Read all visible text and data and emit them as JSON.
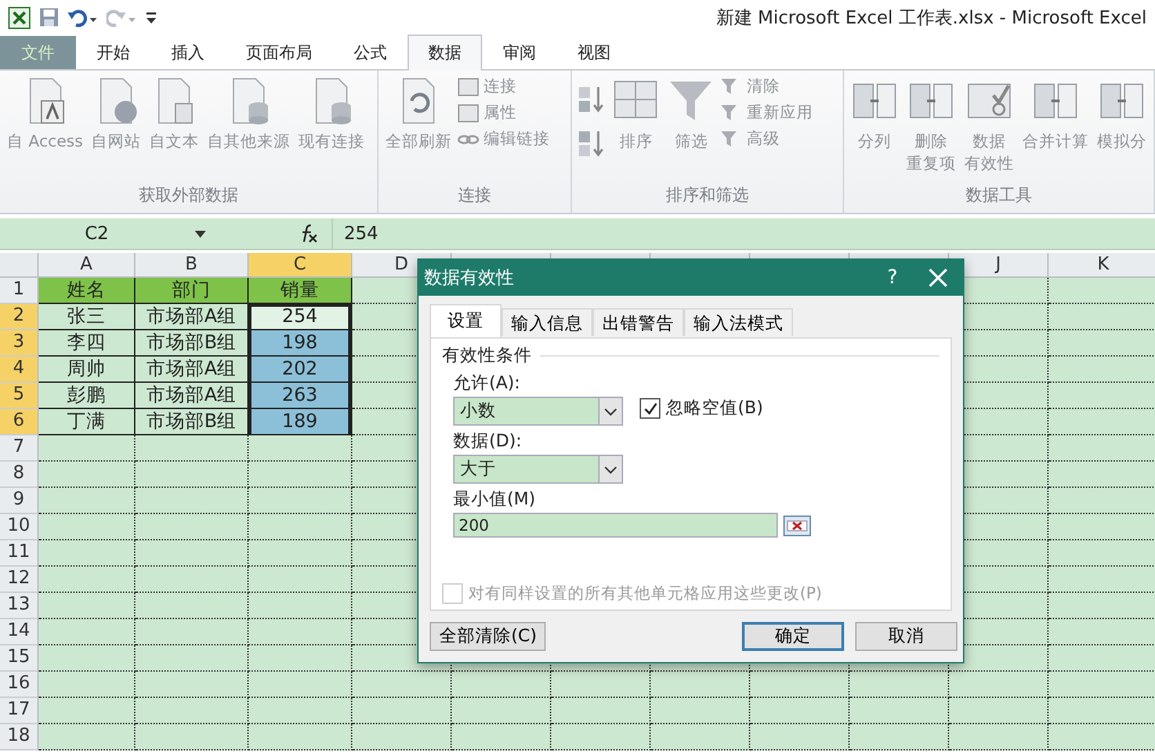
{
  "title_bar": {
    "title": "新建 Microsoft Excel 工作表.xlsx  -  Microsoft Excel"
  },
  "ribbon_tabs": [
    {
      "label": "文件",
      "kind": "file",
      "selected": false
    },
    {
      "label": "开始",
      "kind": "tab",
      "selected": false
    },
    {
      "label": "插入",
      "kind": "tab",
      "selected": false
    },
    {
      "label": "页面布局",
      "kind": "tab",
      "selected": false
    },
    {
      "label": "公式",
      "kind": "tab",
      "selected": false
    },
    {
      "label": "数据",
      "kind": "tab",
      "selected": true
    },
    {
      "label": "审阅",
      "kind": "tab",
      "selected": false
    },
    {
      "label": "视图",
      "kind": "tab",
      "selected": false
    }
  ],
  "ribbon_groups": [
    {
      "label": "获取外部数据",
      "commands": [
        {
          "kind": "large",
          "label": "自 Access"
        },
        {
          "kind": "large",
          "label": "自网站"
        },
        {
          "kind": "large",
          "label": "自文本"
        },
        {
          "kind": "large",
          "label": "自其他来源"
        },
        {
          "kind": "large",
          "label": "现有连接"
        }
      ]
    },
    {
      "label": "连接",
      "commands": [
        {
          "kind": "large",
          "label": "全部刷新"
        },
        {
          "kind": "small",
          "label": "连接"
        },
        {
          "kind": "small",
          "label": "属性"
        },
        {
          "kind": "small",
          "label": "编辑链接"
        }
      ]
    },
    {
      "label": "排序和筛选",
      "commands": [
        {
          "kind": "sortpair"
        },
        {
          "kind": "large",
          "label": "排序"
        },
        {
          "kind": "large",
          "label": "筛选"
        },
        {
          "kind": "small",
          "label": "清除"
        },
        {
          "kind": "small",
          "label": "重新应用"
        },
        {
          "kind": "small",
          "label": "高级"
        }
      ]
    },
    {
      "label": "数据工具",
      "commands": [
        {
          "kind": "large",
          "label": "分列"
        },
        {
          "kind": "large",
          "lines": [
            "删除",
            "重复项"
          ]
        },
        {
          "kind": "large",
          "lines": [
            "数据",
            "有效性"
          ]
        },
        {
          "kind": "large",
          "label": "合并计算"
        },
        {
          "kind": "large",
          "label": "模拟分"
        }
      ]
    }
  ],
  "formula_bar": {
    "name_box": "C2",
    "value": "254"
  },
  "sheet": {
    "columns": [
      {
        "label": "A",
        "selected": false
      },
      {
        "label": "B",
        "selected": false
      },
      {
        "label": "C",
        "selected": true
      },
      {
        "label": "D",
        "selected": false
      },
      {
        "label": "J",
        "selected": false
      },
      {
        "label": "K",
        "selected": false
      }
    ],
    "rows": [
      {
        "label": "1",
        "selected": false,
        "kind": "header",
        "cells": [
          {
            "text": "姓名",
            "selected": false
          },
          {
            "text": "部门",
            "selected": false
          },
          {
            "text": "销量",
            "selected": false
          }
        ]
      },
      {
        "label": "2",
        "selected": true,
        "kind": "data",
        "cells": [
          {
            "text": "张三",
            "selected": false
          },
          {
            "text": "市场部A组",
            "selected": false
          },
          {
            "text": "254",
            "selected": true,
            "active": true
          }
        ]
      },
      {
        "label": "3",
        "selected": true,
        "kind": "data",
        "cells": [
          {
            "text": "李四",
            "selected": false
          },
          {
            "text": "市场部B组",
            "selected": false
          },
          {
            "text": "198",
            "selected": true,
            "active": false
          }
        ]
      },
      {
        "label": "4",
        "selected": true,
        "kind": "data",
        "cells": [
          {
            "text": "周帅",
            "selected": false
          },
          {
            "text": "市场部A组",
            "selected": false
          },
          {
            "text": "202",
            "selected": true,
            "active": false
          }
        ]
      },
      {
        "label": "5",
        "selected": true,
        "kind": "data",
        "cells": [
          {
            "text": "彭鹏",
            "selected": false
          },
          {
            "text": "市场部A组",
            "selected": false
          },
          {
            "text": "263",
            "selected": true,
            "active": false
          }
        ]
      },
      {
        "label": "6",
        "selected": true,
        "kind": "data",
        "cells": [
          {
            "text": "丁满",
            "selected": false
          },
          {
            "text": "市场部B组",
            "selected": false
          },
          {
            "text": "189",
            "selected": true,
            "active": false
          }
        ]
      },
      {
        "label": "7",
        "selected": false,
        "kind": "empty"
      },
      {
        "label": "8",
        "selected": false,
        "kind": "empty"
      },
      {
        "label": "9",
        "selected": false,
        "kind": "empty"
      },
      {
        "label": "10",
        "selected": false,
        "kind": "empty"
      },
      {
        "label": "11",
        "selected": false,
        "kind": "empty"
      },
      {
        "label": "12",
        "selected": false,
        "kind": "empty"
      },
      {
        "label": "13",
        "selected": false,
        "kind": "empty"
      },
      {
        "label": "14",
        "selected": false,
        "kind": "empty"
      },
      {
        "label": "15",
        "selected": false,
        "kind": "empty"
      },
      {
        "label": "16",
        "selected": false,
        "kind": "empty"
      },
      {
        "label": "17",
        "selected": false,
        "kind": "empty"
      },
      {
        "label": "18",
        "selected": false,
        "kind": "empty"
      }
    ]
  },
  "dialog": {
    "title": "数据有效性",
    "help": "?",
    "tabs": [
      {
        "label": "设置",
        "selected": true
      },
      {
        "label": "输入信息",
        "selected": false
      },
      {
        "label": "出错警告",
        "selected": false
      },
      {
        "label": "输入法模式",
        "selected": false
      }
    ],
    "section": "有效性条件",
    "allow": {
      "label": "允许(A):",
      "value": "小数"
    },
    "ignore_blank": {
      "label": "忽略空值(B)",
      "checked": true
    },
    "data": {
      "label": "数据(D):",
      "value": "大于"
    },
    "minimum": {
      "label": "最小值(M)",
      "value": "200"
    },
    "apply_all": {
      "label": "对有同样设置的所有其他单元格应用这些更改(P)",
      "checked": false
    },
    "buttons": [
      {
        "label": "全部清除(C)",
        "kind": "left",
        "default": false
      },
      {
        "label": "确定",
        "kind": "right",
        "default": true
      },
      {
        "label": "取消",
        "kind": "right",
        "default": false
      }
    ]
  }
}
